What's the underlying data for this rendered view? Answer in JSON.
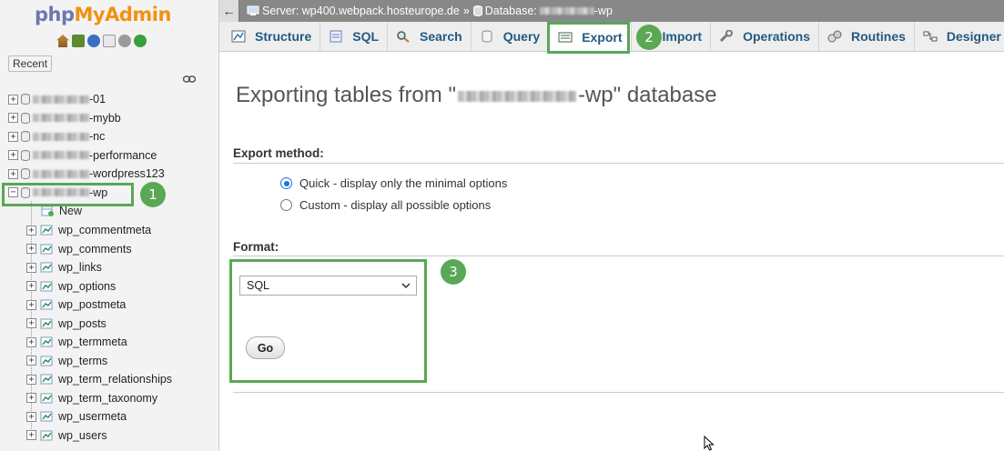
{
  "sidebar": {
    "logo_php": "php",
    "logo_admin": "MyAdmin",
    "recent_label": "Recent",
    "databases": [
      {
        "suffix": "-01",
        "expander": "+"
      },
      {
        "suffix": "-mybb",
        "expander": "+"
      },
      {
        "suffix": "-nc",
        "expander": "+"
      },
      {
        "suffix": "-performance",
        "expander": "+"
      },
      {
        "suffix": "-wordpress123",
        "expander": "+"
      },
      {
        "suffix": "-wp",
        "expander": "−"
      }
    ],
    "new_label": "New",
    "tables": [
      "wp_commentmeta",
      "wp_comments",
      "wp_links",
      "wp_options",
      "wp_postmeta",
      "wp_posts",
      "wp_termmeta",
      "wp_terms",
      "wp_term_relationships",
      "wp_term_taxonomy",
      "wp_usermeta",
      "wp_users"
    ]
  },
  "breadcrumb": {
    "back": "←",
    "server": "Server: wp400.webpack.hosteurope.de",
    "separator": "»",
    "database_prefix": "Database:",
    "database_suffix": "-wp"
  },
  "tabs": {
    "structure": "Structure",
    "sql": "SQL",
    "search": "Search",
    "query": "Query",
    "export": "Export",
    "import": "Import",
    "operations": "Operations",
    "routines": "Routines",
    "designer": "Designer"
  },
  "main": {
    "title_prefix": "Exporting tables from \"",
    "title_suffix": "-wp\" database",
    "export_method_label": "Export method:",
    "quick_option": "Quick - display only the minimal options",
    "custom_option": "Custom - display all possible options",
    "format_label": "Format:",
    "format_value": "SQL",
    "go_label": "Go"
  },
  "annotations": {
    "badge_1": "1",
    "badge_2": "2",
    "badge_3": "3",
    "color": "#5aa855"
  },
  "colors": {
    "logo_php": "#6c78af",
    "logo_admin": "#f29111",
    "tab_text": "#235a81",
    "topbar": "#888888"
  }
}
